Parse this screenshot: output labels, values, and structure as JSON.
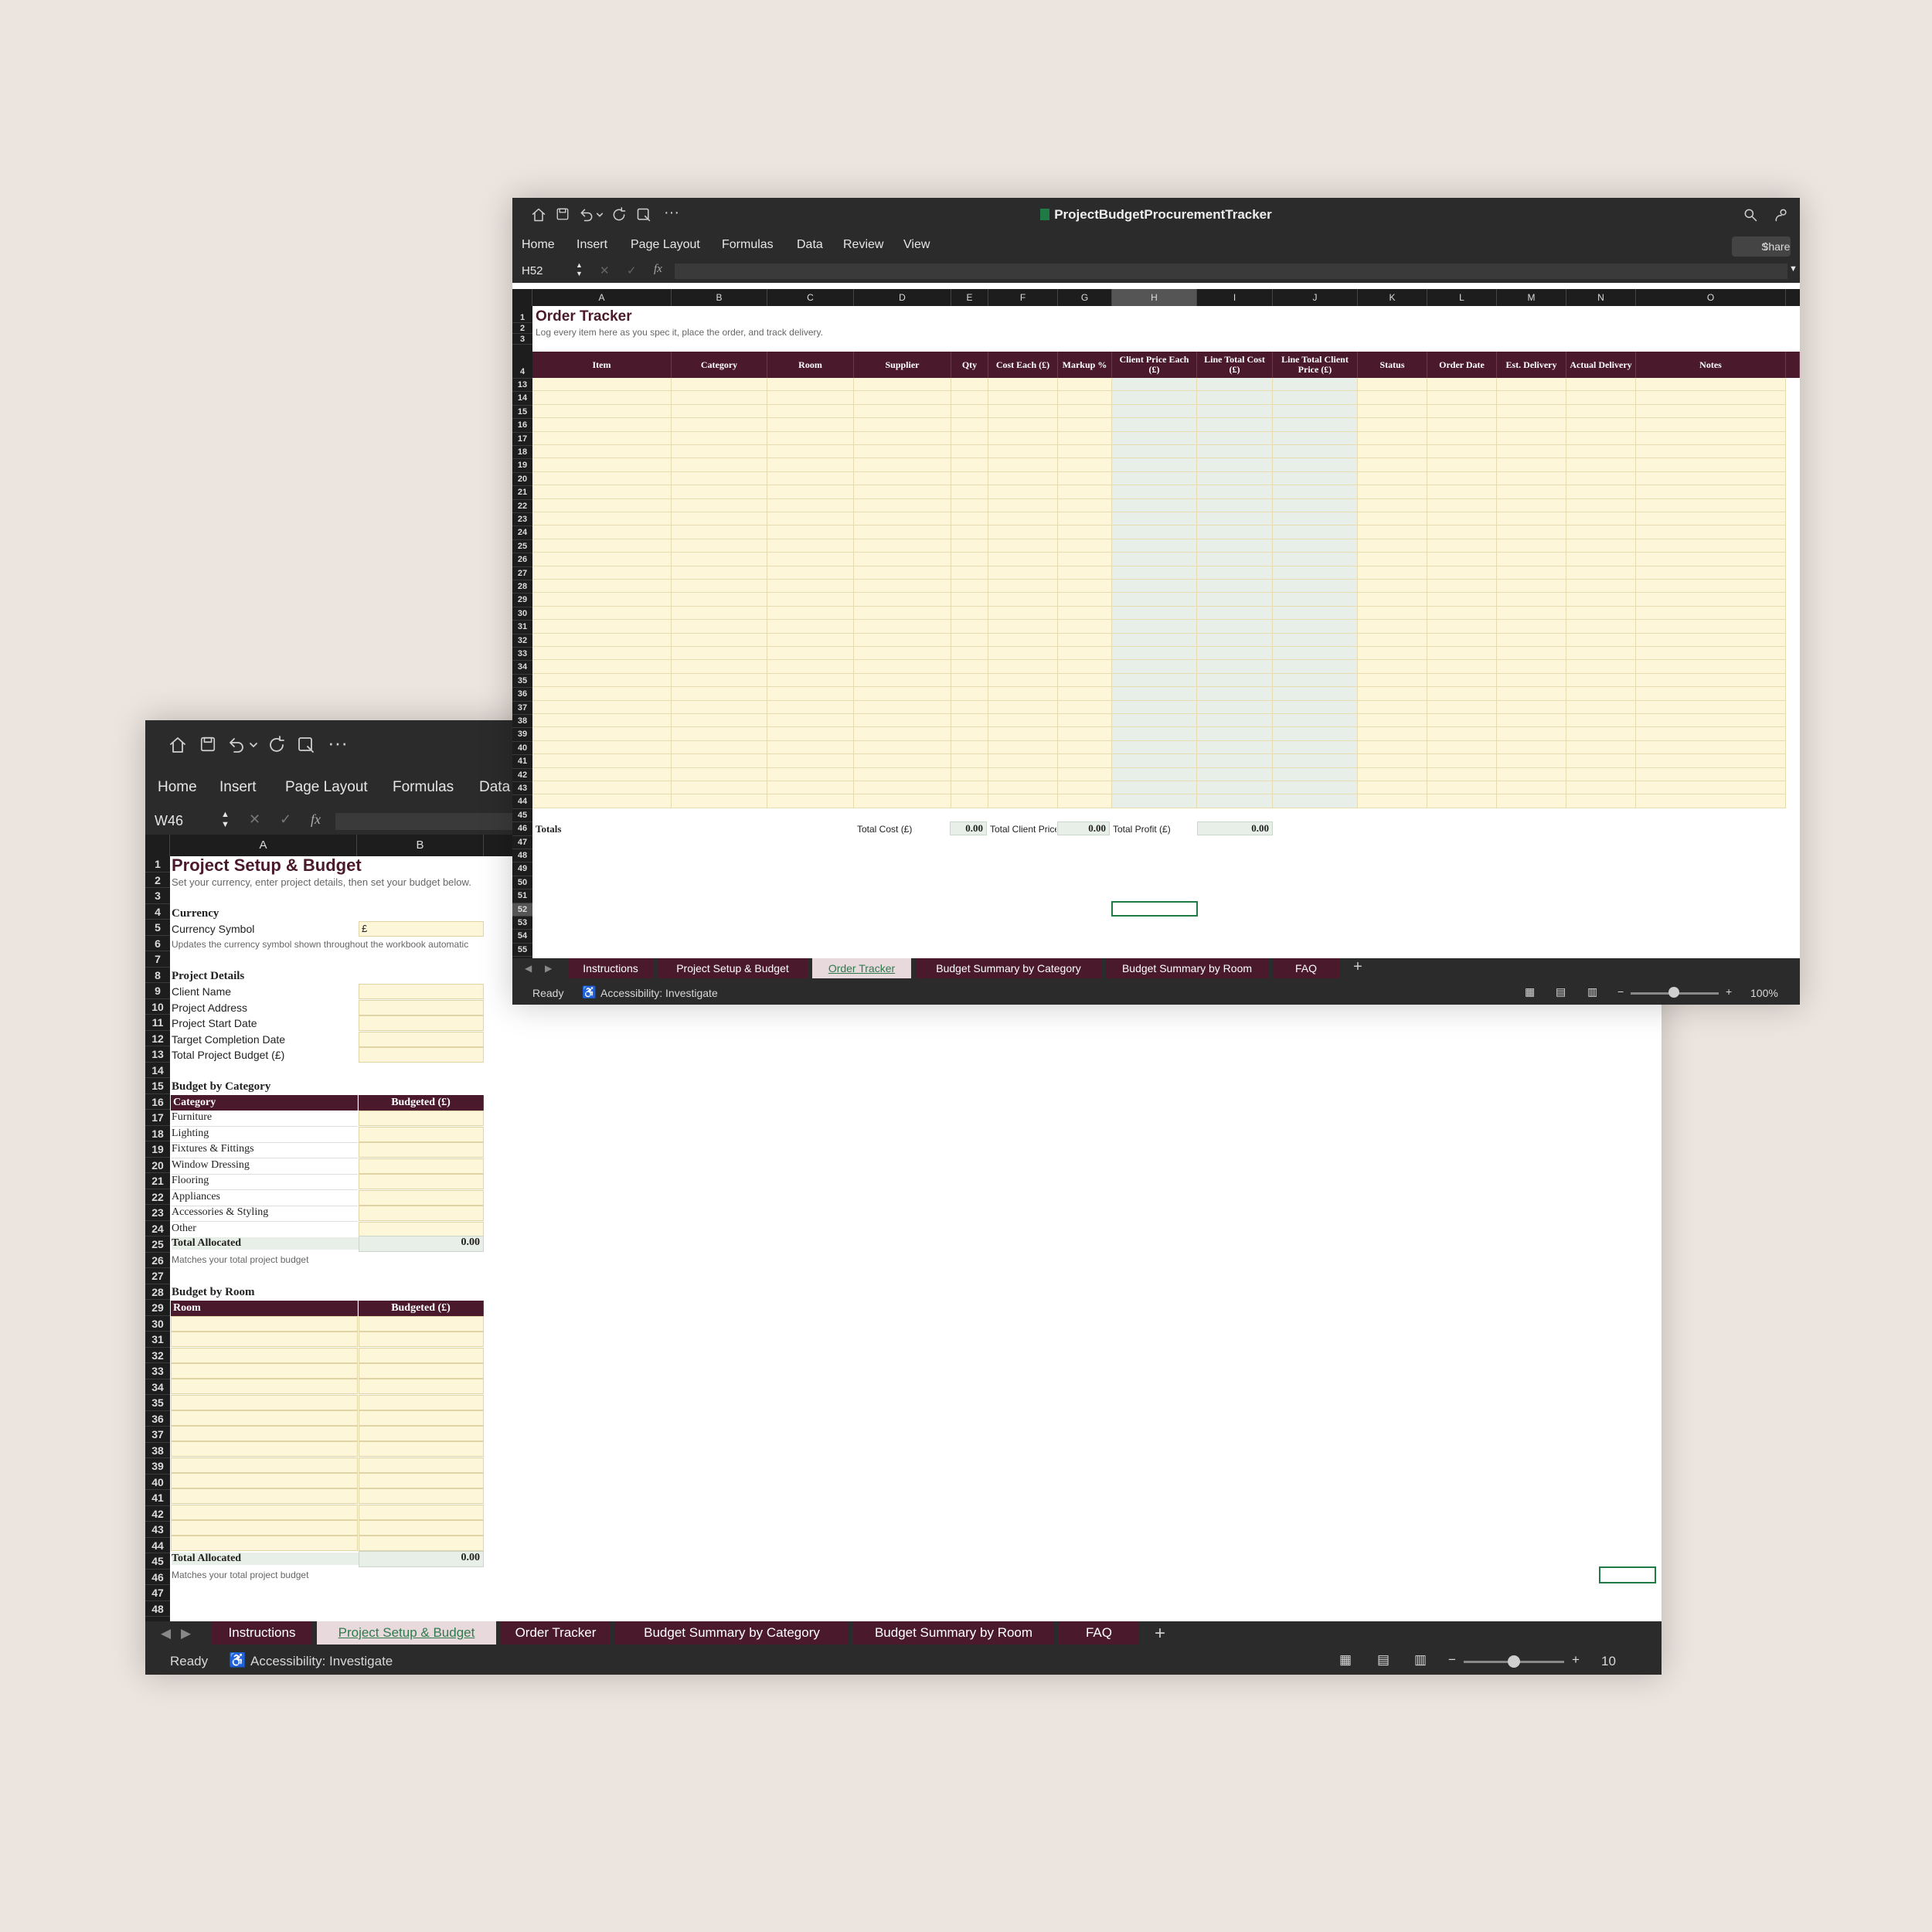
{
  "colors": {
    "accent": "#4a1a2c",
    "input_fill": "#fdf6d9",
    "calc_fill": "#e8efe8",
    "active_tab_text": "#2f7a4d"
  },
  "front": {
    "file_name": "ProjectBudgetProcurementTracker",
    "menu": [
      "Home",
      "Insert",
      "Page Layout",
      "Formulas",
      "Data",
      "Review",
      "View"
    ],
    "share": "Share",
    "name_box": "H52",
    "fx": "fx",
    "columns": [
      "A",
      "B",
      "C",
      "D",
      "E",
      "F",
      "G",
      "H",
      "I",
      "J",
      "K",
      "L",
      "M",
      "N",
      "O"
    ],
    "title": "Order Tracker",
    "subtitle": "Log every item here as you spec it, place the order, and track delivery.",
    "headers": [
      "Item",
      "Category",
      "Room",
      "Supplier",
      "Qty",
      "Cost Each (£)",
      "Markup %",
      "Client Price Each (£)",
      "Line Total Cost (£)",
      "Line Total Client Price (£)",
      "Status",
      "Order Date",
      "Est. Delivery",
      "Actual Delivery",
      "Notes"
    ],
    "row_numbers": [
      "1",
      "2",
      "3",
      "4",
      "13",
      "14",
      "15",
      "16",
      "17",
      "18",
      "19",
      "20",
      "21",
      "22",
      "23",
      "24",
      "25",
      "26",
      "27",
      "28",
      "29",
      "30",
      "31",
      "32",
      "33",
      "34",
      "35",
      "36",
      "37",
      "38",
      "39",
      "40",
      "41",
      "42",
      "43",
      "44",
      "45",
      "46",
      "47",
      "48",
      "49",
      "50",
      "51",
      "52",
      "53",
      "54",
      "55"
    ],
    "totals": {
      "label": "Totals",
      "cost_label": "Total Cost (£)",
      "cost_value": "0.00",
      "client_label": "Total Client Price",
      "client_value": "0.00",
      "profit_label": "Total Profit (£)",
      "profit_value": "0.00"
    },
    "tabs": [
      "Instructions",
      "Project Setup & Budget",
      "Order Tracker",
      "Budget Summary by Category",
      "Budget Summary by Room",
      "FAQ"
    ],
    "active_tab": "Order Tracker",
    "status": {
      "ready": "Ready",
      "accessibility": "Accessibility: Investigate",
      "zoom": "100%",
      "zoom_level": 0.5
    }
  },
  "back": {
    "menu": [
      "Home",
      "Insert",
      "Page Layout",
      "Formulas",
      "Data"
    ],
    "name_box": "W46",
    "fx": "fx",
    "columns": [
      "A",
      "B"
    ],
    "title": "Project Setup & Budget",
    "subtitle": "Set your currency, enter project details, then set your budget below.",
    "currency_heading": "Currency",
    "currency_label": "Currency Symbol",
    "currency_value": "£",
    "currency_note": "Updates the currency symbol shown throughout the workbook automatic",
    "details_heading": "Project Details",
    "details": [
      "Client Name",
      "Project Address",
      "Project Start Date",
      "Target Completion Date",
      "Total Project Budget (£)"
    ],
    "category_heading": "Budget by Category",
    "category_col": "Category",
    "budget_col": "Budgeted (£)",
    "categories": [
      "Furniture",
      "Lighting",
      "Fixtures & Fittings",
      "Window Dressing",
      "Flooring",
      "Appliances",
      "Accessories & Styling",
      "Other"
    ],
    "total_allocated": "Total Allocated",
    "total_value": "0.00",
    "matches_note": "Matches your total project budget",
    "room_heading": "Budget by Room",
    "room_col": "Room",
    "room_total_value": "0.00",
    "row_numbers": [
      "1",
      "2",
      "3",
      "4",
      "5",
      "6",
      "7",
      "8",
      "9",
      "10",
      "11",
      "12",
      "13",
      "14",
      "15",
      "16",
      "17",
      "18",
      "19",
      "20",
      "21",
      "22",
      "23",
      "24",
      "25",
      "26",
      "27",
      "28",
      "29",
      "30",
      "31",
      "32",
      "33",
      "34",
      "35",
      "36",
      "37",
      "38",
      "39",
      "40",
      "41",
      "42",
      "43",
      "44",
      "45",
      "46",
      "47",
      "48"
    ],
    "tabs": [
      "Instructions",
      "Project Setup & Budget",
      "Order Tracker",
      "Budget Summary by Category",
      "Budget Summary by Room",
      "FAQ"
    ],
    "active_tab": "Project Setup & Budget",
    "status": {
      "ready": "Ready",
      "accessibility": "Accessibility: Investigate",
      "zoom": "10",
      "zoom_level": 0.5
    }
  }
}
